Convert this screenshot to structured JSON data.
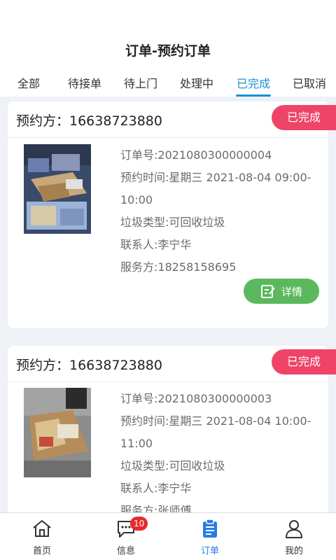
{
  "header": {
    "title": "订单-预约订单"
  },
  "tabs": [
    {
      "label": "全部"
    },
    {
      "label": "待接单"
    },
    {
      "label": "待上门"
    },
    {
      "label": "处理中"
    },
    {
      "label": "已完成"
    },
    {
      "label": "已取消"
    }
  ],
  "active_tab": "已完成",
  "orders": [
    {
      "customer": "预约方：16638723880",
      "status": "已完成",
      "order_no": "订单号:2021080300000004",
      "time_line1": "预约时间:星期三 2021-08-04 09:00-",
      "time_line2": "10:00",
      "waste_type": "垃圾类型:可回收垃圾",
      "contact": "联系人:李宁华",
      "provider": "服务方:18258158695",
      "detail_label": "详情"
    },
    {
      "customer": "预约方：16638723880",
      "status": "已完成",
      "order_no": "订单号:2021080300000003",
      "time_line1": "预约时间:星期三 2021-08-04 10:00-",
      "time_line2": "11:00",
      "waste_type": "垃圾类型:可回收垃圾",
      "contact": "联系人:李宁华",
      "provider": "服务方:张师傅"
    }
  ],
  "bottom_nav": [
    {
      "label": "首页",
      "icon": "home-icon"
    },
    {
      "label": "信息",
      "icon": "message-icon",
      "badge": "10"
    },
    {
      "label": "订单",
      "icon": "clipboard-icon"
    },
    {
      "label": "我的",
      "icon": "user-icon"
    }
  ],
  "active_nav": "订单",
  "colors": {
    "accent": "#1a8fd6",
    "status": "#ee4468",
    "detail_button": "#5cb85c",
    "nav_active": "#2a7be4",
    "badge": "#e52b2b"
  }
}
